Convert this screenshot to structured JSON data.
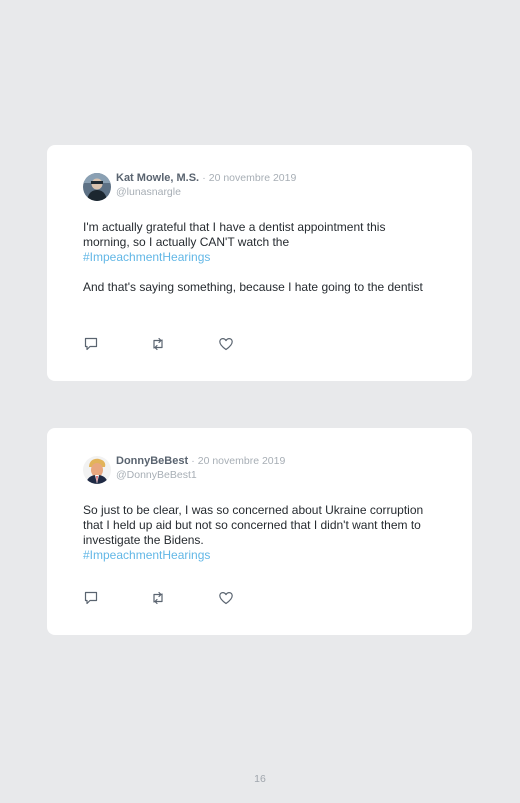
{
  "tweets": [
    {
      "author_name": "Kat Mowle, M.S.",
      "separator": "·",
      "date": "20 novembre 2019",
      "handle": "@lunasnargle",
      "paragraphs": [
        {
          "text": "I'm actually grateful that I have a dentist appointment this morning, so I actually CAN'T watch the",
          "hashtag": "#ImpeachmentHearings"
        },
        {
          "text": "And that's saying something, because I hate going to the dentist",
          "hashtag": ""
        }
      ],
      "icons": [
        "reply-icon",
        "retweet-icon",
        "like-icon"
      ]
    },
    {
      "author_name": "DonnyBeBest",
      "separator": "·",
      "date": "20 novembre 2019",
      "handle": "@DonnyBeBest1",
      "paragraphs": [
        {
          "text": "So just to be clear, I was so concerned about Ukraine corruption that I held up aid but not so concerned that I didn't want them to investigate the Bidens.",
          "hashtag": "#ImpeachmentHearings"
        }
      ],
      "icons": [
        "reply-icon",
        "retweet-icon",
        "like-icon"
      ]
    }
  ],
  "page_number": "16",
  "colors": {
    "background": "#e8e9eb",
    "card": "#ffffff",
    "hashtag": "#62b7e6",
    "muted": "#a7aeb5",
    "name": "#5a6470",
    "text": "#262b30"
  }
}
